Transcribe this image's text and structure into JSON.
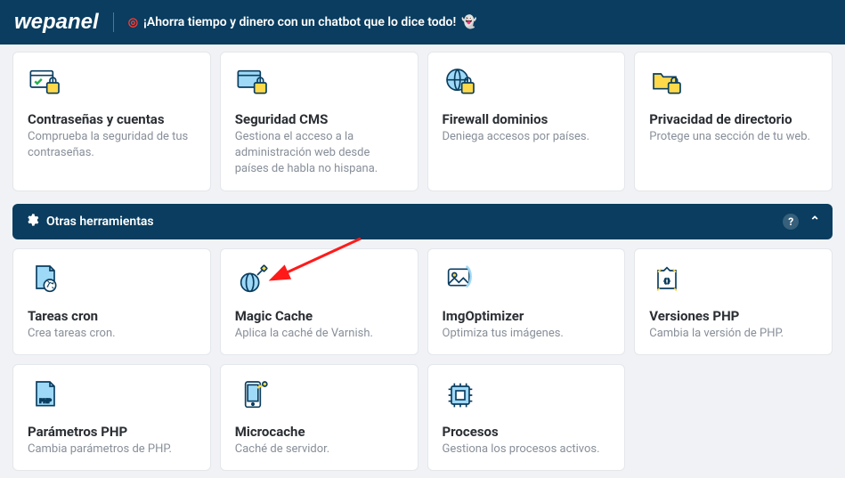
{
  "header": {
    "brand": "wepanel",
    "promo": "¡Ahorra tiempo y dinero con un chatbot que lo dice todo!"
  },
  "top_cards": [
    {
      "title": "Contraseñas y cuentas",
      "desc": "Comprueba la seguridad de tus contraseñas.",
      "icon": "password-account-icon"
    },
    {
      "title": "Seguridad CMS",
      "desc": "Gestiona el acceso a la administración web desde países de habla no hispana.",
      "icon": "cms-security-icon"
    },
    {
      "title": "Firewall dominios",
      "desc": "Deniega accesos por países.",
      "icon": "firewall-domains-icon"
    },
    {
      "title": "Privacidad de directorio",
      "desc": "Protege una sección de tu web.",
      "icon": "directory-privacy-icon"
    }
  ],
  "section": {
    "title": "Otras herramientas"
  },
  "tool_cards": [
    {
      "title": "Tareas cron",
      "desc": "Crea tareas cron.",
      "icon": "cron-icon"
    },
    {
      "title": "Magic Cache",
      "desc": "Aplica la caché de Varnish.",
      "icon": "magic-cache-icon"
    },
    {
      "title": "ImgOptimizer",
      "desc": "Optimiza tus imágenes.",
      "icon": "img-optimizer-icon"
    },
    {
      "title": "Versiones PHP",
      "desc": "Cambia la versión de PHP.",
      "icon": "php-versions-icon"
    },
    {
      "title": "Parámetros PHP",
      "desc": "Cambia parámetros de PHP.",
      "icon": "php-params-icon"
    },
    {
      "title": "Microcache",
      "desc": "Caché de servidor.",
      "icon": "microcache-icon"
    },
    {
      "title": "Procesos",
      "desc": "Gestiona los procesos activos.",
      "icon": "processes-icon"
    }
  ]
}
